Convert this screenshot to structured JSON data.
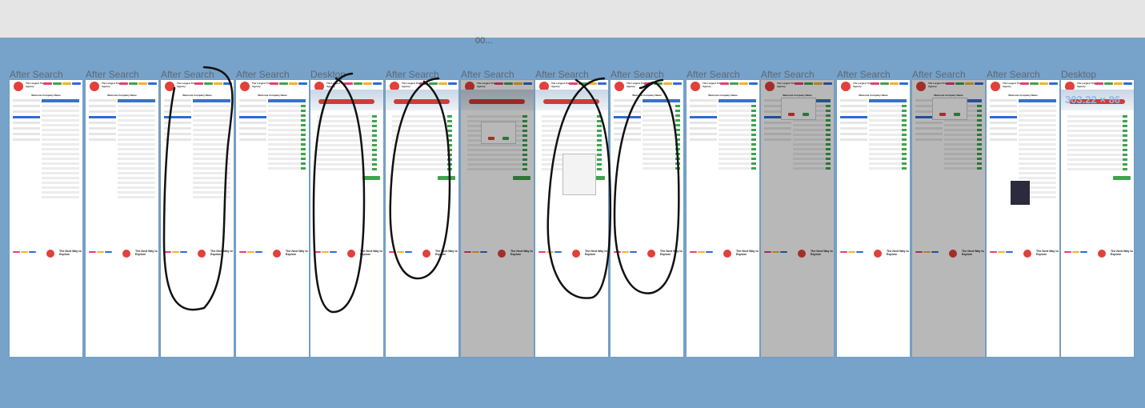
{
  "canvas": {
    "label": "00...",
    "colors": {
      "canvas": "#77a2c9",
      "toolbar": "#e5e5e5",
      "accent": "#2e6bd6",
      "brand": "#e2403a",
      "success": "#3fa34d"
    }
  },
  "frames": [
    {
      "label": "After Search",
      "variant": "form"
    },
    {
      "label": "After Search",
      "variant": "form"
    },
    {
      "label": "After Search",
      "variant": "form"
    },
    {
      "label": "After Search",
      "variant": "list"
    },
    {
      "label": "Desktop",
      "variant": "plane"
    },
    {
      "label": "After Search",
      "variant": "plane"
    },
    {
      "label": "After Search",
      "variant": "plane-dim"
    },
    {
      "label": "After Search",
      "variant": "plane"
    },
    {
      "label": "After Search",
      "variant": "list"
    },
    {
      "label": "After Search",
      "variant": "list"
    },
    {
      "label": "After Search",
      "variant": "list-dim"
    },
    {
      "label": "After Search",
      "variant": "list"
    },
    {
      "label": "After Search",
      "variant": "list-dim"
    },
    {
      "label": "After Search",
      "variant": "form"
    },
    {
      "label": "Desktop",
      "variant": "plane"
    }
  ],
  "frame_content": {
    "brand": "The Largest Travel Agency",
    "welcome": "Welcome Company Name",
    "footer_tagline": "The Next Way to Explore"
  },
  "desktop_size_readout": "303.22 × 86"
}
